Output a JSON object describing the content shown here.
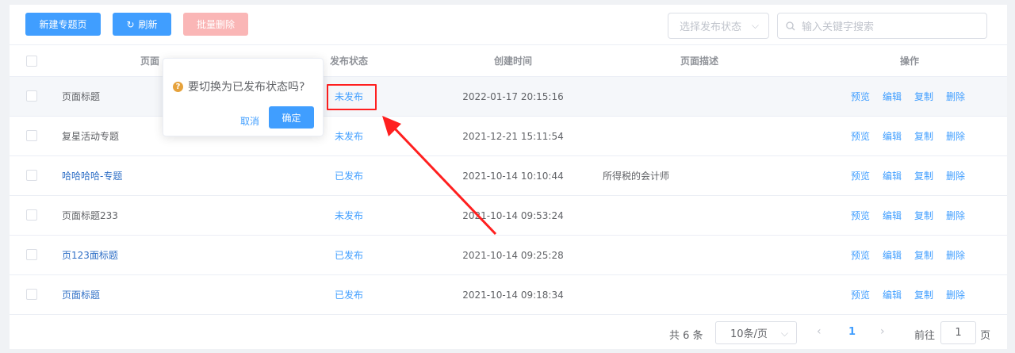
{
  "toolbar": {
    "new_label": "新建专题页",
    "refresh_label": "刷新",
    "batch_delete_label": "批量删除",
    "status_select_placeholder": "选择发布状态",
    "search_placeholder": "输入关键字搜索"
  },
  "table": {
    "headers": {
      "title": "页面",
      "status": "发布状态",
      "created": "创建时间",
      "desc": "页面描述",
      "ops": "操作"
    },
    "op_labels": [
      "预览",
      "编辑",
      "复制",
      "删除"
    ],
    "rows": [
      {
        "title": "页面标题",
        "status": "未发布",
        "created": "2022-01-17 20:15:16",
        "desc": ""
      },
      {
        "title": "复星活动专题",
        "status": "未发布",
        "created": "2021-12-21 15:11:54",
        "desc": ""
      },
      {
        "title": "哈哈哈哈-专题",
        "status": "已发布",
        "created": "2021-10-14 10:10:44",
        "desc": "所得税的会计师"
      },
      {
        "title": "页面标题233",
        "status": "未发布",
        "created": "2021-10-14 09:53:24",
        "desc": ""
      },
      {
        "title": "页123面标题",
        "status": "已发布",
        "created": "2021-10-14 09:25:28",
        "desc": ""
      },
      {
        "title": "页面标题",
        "status": "已发布",
        "created": "2021-10-14 09:18:34",
        "desc": ""
      }
    ]
  },
  "popconfirm": {
    "message": "要切换为已发布状态吗?",
    "cancel_label": "取消",
    "confirm_label": "确定"
  },
  "pagination": {
    "total_text": "共 6 条",
    "page_size": "10条/页",
    "current_page": "1",
    "goto_prefix": "前往",
    "goto_value": "1",
    "goto_suffix": "页"
  },
  "colors": {
    "primary": "#409eff",
    "danger_disabled": "#fab6b6",
    "warning": "#e6a23c",
    "annotation_red": "#ff1f1f"
  }
}
